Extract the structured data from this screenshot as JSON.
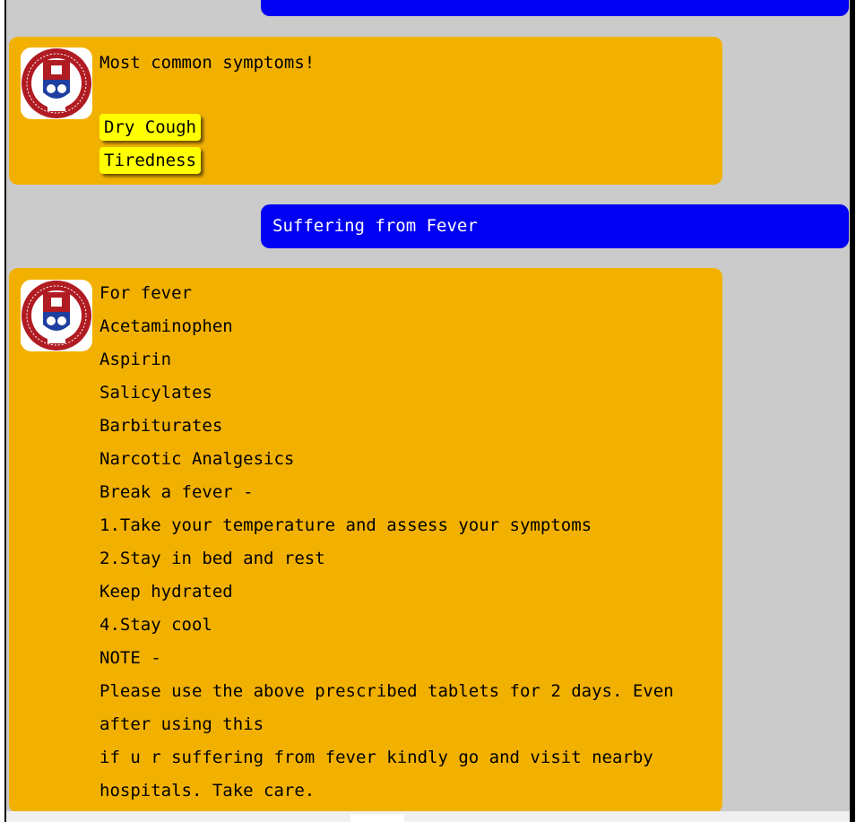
{
  "conversation": {
    "bot_symptoms": {
      "title": "Most common symptoms!",
      "options": [
        "Dry Cough",
        "Tiredness"
      ]
    },
    "user_message": "Suffering from Fever",
    "bot_fever": {
      "lines": [
        "For fever",
        "Acetaminophen",
        "Aspirin",
        "Salicylates",
        "Barbiturates",
        "Narcotic Analgesics",
        "Break a fever -",
        "1.Take your temperature and assess your symptoms",
        "2.Stay in bed and rest",
        "Keep hydrated",
        "4.Stay cool",
        "NOTE -",
        "Please use the above prescribed tablets for 2 days. Even",
        "after using this",
        "if u r suffering from fever kindly go and visit nearby",
        "hospitals. Take care."
      ]
    }
  },
  "avatar": {
    "icon": "institution-seal-logo",
    "ring_color": "#b01c22",
    "shield_blue": "#1f3ea0"
  },
  "colors": {
    "bot_bubble": "#f2b100",
    "user_bubble": "#0000f2",
    "chip": "#ffff00",
    "background": "#cbcbcb"
  }
}
